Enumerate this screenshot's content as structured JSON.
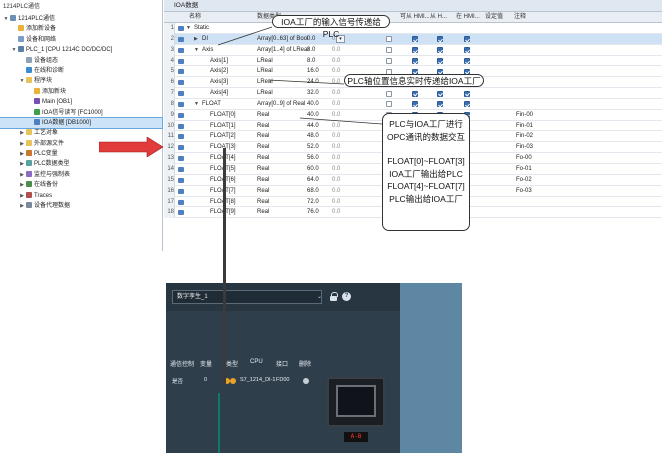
{
  "tree": {
    "header": "1214PLC通信",
    "items": [
      {
        "label": "1214PLC通信",
        "level": 0,
        "expand": "▼",
        "icon": "proj",
        "selected": false
      },
      {
        "label": "添加新设备",
        "level": 1,
        "expand": "",
        "icon": "add",
        "selected": false
      },
      {
        "label": "设备和网络",
        "level": 1,
        "expand": "",
        "icon": "dev",
        "selected": false
      },
      {
        "label": "PLC_1 [CPU 1214C DC/DC/DC]",
        "level": 1,
        "expand": "▼",
        "icon": "plc",
        "selected": false
      },
      {
        "label": "设备组态",
        "level": 2,
        "expand": "",
        "icon": "cfg",
        "selected": false
      },
      {
        "label": "在线和诊断",
        "level": 2,
        "expand": "",
        "icon": "diag",
        "selected": false
      },
      {
        "label": "程序块",
        "level": 2,
        "expand": "▼",
        "icon": "folder",
        "selected": false
      },
      {
        "label": "添加新块",
        "level": 3,
        "expand": "",
        "icon": "add",
        "selected": false
      },
      {
        "label": "Main [OB1]",
        "level": 3,
        "expand": "",
        "icon": "main",
        "selected": false
      },
      {
        "label": "IOA信号读写 [FC1000]",
        "level": 3,
        "expand": "",
        "icon": "fc",
        "selected": false
      },
      {
        "label": "IOA数据 [DB1000]",
        "level": 3,
        "expand": "",
        "icon": "db",
        "selected": true
      },
      {
        "label": "工艺对象",
        "level": 2,
        "expand": "▶",
        "icon": "folder",
        "selected": false
      },
      {
        "label": "外部源文件",
        "level": 2,
        "expand": "▶",
        "icon": "folder",
        "selected": false
      },
      {
        "label": "PLC变量",
        "level": 2,
        "expand": "▶",
        "icon": "tag",
        "selected": false
      },
      {
        "label": "PLC数据类型",
        "level": 2,
        "expand": "▶",
        "icon": "dtype",
        "selected": false
      },
      {
        "label": "监控与强制表",
        "level": 2,
        "expand": "▶",
        "icon": "watch",
        "selected": false
      },
      {
        "label": "在线备份",
        "level": 2,
        "expand": "▶",
        "icon": "online",
        "selected": false
      },
      {
        "label": "Traces",
        "level": 2,
        "expand": "▶",
        "icon": "trace",
        "selected": false
      },
      {
        "label": "设备代理数据",
        "level": 2,
        "expand": "▶",
        "icon": "dev2",
        "selected": false
      }
    ]
  },
  "editor": {
    "title": "IOA数据",
    "columns": {
      "name": "名称",
      "datatype": "数据类型",
      "accessible": "可从 HMI...",
      "writable": "从 H...",
      "visible": "在 HMI...",
      "setpoint": "设定值",
      "comment": "注释"
    },
    "rows": [
      {
        "num": "1",
        "indent": 0,
        "expand": "▼",
        "name": "Static",
        "type": "",
        "start": "",
        "acc": null,
        "wr": null,
        "vis": null,
        "sp": null,
        "comment": "",
        "selected": false
      },
      {
        "num": "2",
        "indent": 1,
        "expand": "▶",
        "name": "DI",
        "type": "Array[0..63] of Bool",
        "start": "0.0",
        "acc": true,
        "wr": true,
        "vis": true,
        "sp": false,
        "comment": "",
        "selected": true,
        "dropdown": true
      },
      {
        "num": "3",
        "indent": 1,
        "expand": "▼",
        "name": "Axis",
        "type": "Array[1..4] of LReal",
        "start": "8.0",
        "acc": true,
        "wr": true,
        "vis": true,
        "sp": false,
        "comment": "",
        "selected": false
      },
      {
        "num": "4",
        "indent": 2,
        "expand": "",
        "name": "Axis[1]",
        "type": "LReal",
        "start": "8.0",
        "acc": true,
        "wr": true,
        "vis": true,
        "sp": false,
        "comment": "",
        "selected": false
      },
      {
        "num": "5",
        "indent": 2,
        "expand": "",
        "name": "Axis[2]",
        "type": "LReal",
        "start": "16.0",
        "acc": true,
        "wr": true,
        "vis": true,
        "sp": false,
        "comment": "",
        "selected": false
      },
      {
        "num": "6",
        "indent": 2,
        "expand": "",
        "name": "Axis[3]",
        "type": "LReal",
        "start": "24.0",
        "acc": true,
        "wr": true,
        "vis": true,
        "sp": false,
        "comment": "",
        "selected": false
      },
      {
        "num": "7",
        "indent": 2,
        "expand": "",
        "name": "Axis[4]",
        "type": "LReal",
        "start": "32.0",
        "acc": true,
        "wr": true,
        "vis": true,
        "sp": false,
        "comment": "",
        "selected": false
      },
      {
        "num": "8",
        "indent": 1,
        "expand": "▼",
        "name": "FLOAT",
        "type": "Array[0..9] of Real",
        "start": "40.0",
        "acc": true,
        "wr": true,
        "vis": true,
        "sp": false,
        "comment": "",
        "selected": false
      },
      {
        "num": "9",
        "indent": 2,
        "expand": "",
        "name": "FLOAT[0]",
        "type": "Real",
        "start": "40.0",
        "acc": true,
        "wr": true,
        "vis": true,
        "sp": false,
        "comment": "Fin-00",
        "selected": false
      },
      {
        "num": "10",
        "indent": 2,
        "expand": "",
        "name": "FLOAT[1]",
        "type": "Real",
        "start": "44.0",
        "acc": true,
        "wr": true,
        "vis": true,
        "sp": false,
        "comment": "Fin-01",
        "selected": false
      },
      {
        "num": "11",
        "indent": 2,
        "expand": "",
        "name": "FLOAT[2]",
        "type": "Real",
        "start": "48.0",
        "acc": true,
        "wr": true,
        "vis": true,
        "sp": false,
        "comment": "Fin-02",
        "selected": false
      },
      {
        "num": "12",
        "indent": 2,
        "expand": "",
        "name": "FLOAT[3]",
        "type": "Real",
        "start": "52.0",
        "acc": true,
        "wr": true,
        "vis": true,
        "sp": false,
        "comment": "Fin-03",
        "selected": false
      },
      {
        "num": "13",
        "indent": 2,
        "expand": "",
        "name": "FLOAT[4]",
        "type": "Real",
        "start": "56.0",
        "acc": true,
        "wr": true,
        "vis": true,
        "sp": false,
        "comment": "Fo-00",
        "selected": false
      },
      {
        "num": "14",
        "indent": 2,
        "expand": "",
        "name": "FLOAT[5]",
        "type": "Real",
        "start": "60.0",
        "acc": true,
        "wr": true,
        "vis": true,
        "sp": false,
        "comment": "Fo-01",
        "selected": false
      },
      {
        "num": "15",
        "indent": 2,
        "expand": "",
        "name": "FLOAT[6]",
        "type": "Real",
        "start": "64.0",
        "acc": true,
        "wr": true,
        "vis": true,
        "sp": false,
        "comment": "Fo-02",
        "selected": false
      },
      {
        "num": "16",
        "indent": 2,
        "expand": "",
        "name": "FLOAT[7]",
        "type": "Real",
        "start": "68.0",
        "acc": true,
        "wr": true,
        "vis": true,
        "sp": false,
        "comment": "Fo-03",
        "selected": false
      },
      {
        "num": "17",
        "indent": 2,
        "expand": "",
        "name": "FLOAT[8]",
        "type": "Real",
        "start": "72.0",
        "acc": true,
        "wr": true,
        "vis": true,
        "sp": false,
        "comment": "",
        "selected": false
      },
      {
        "num": "18",
        "indent": 2,
        "expand": "",
        "name": "FLOAT[9]",
        "type": "Real",
        "start": "76.0",
        "acc": true,
        "wr": true,
        "vis": true,
        "sp": false,
        "comment": "",
        "selected": false
      }
    ],
    "retain_default": "0.0"
  },
  "callouts": {
    "input": "IOA工厂的输入信号传递给PLC",
    "axis": "PLC轴位置信息实时传递给IOA工厂",
    "float_lines": [
      "PLC与IOA工厂进行",
      "OPC通讯的数据交互",
      "",
      "FLOAT[0]~FLOAT[3]",
      "IOA工厂输出给PLC",
      "FLOAT[4]~FLOAT[7]",
      "PLC输出给IOA工厂"
    ]
  },
  "factory": {
    "scene_select": "数字孪生_1",
    "columns": [
      "通信控制",
      "变量",
      "类型",
      "CPU",
      "接口",
      "删除"
    ],
    "row": {
      "control": "是否",
      "vars": "0",
      "type": "",
      "cpu": "S7_1214_DI-1",
      "iface": "FD00"
    },
    "hmi_tag": "A-B",
    "colors": {
      "bg": "#2f3e4b",
      "accent": "#0f7a6a",
      "side": "#5e87a4",
      "alarm": "#ff3030"
    }
  }
}
